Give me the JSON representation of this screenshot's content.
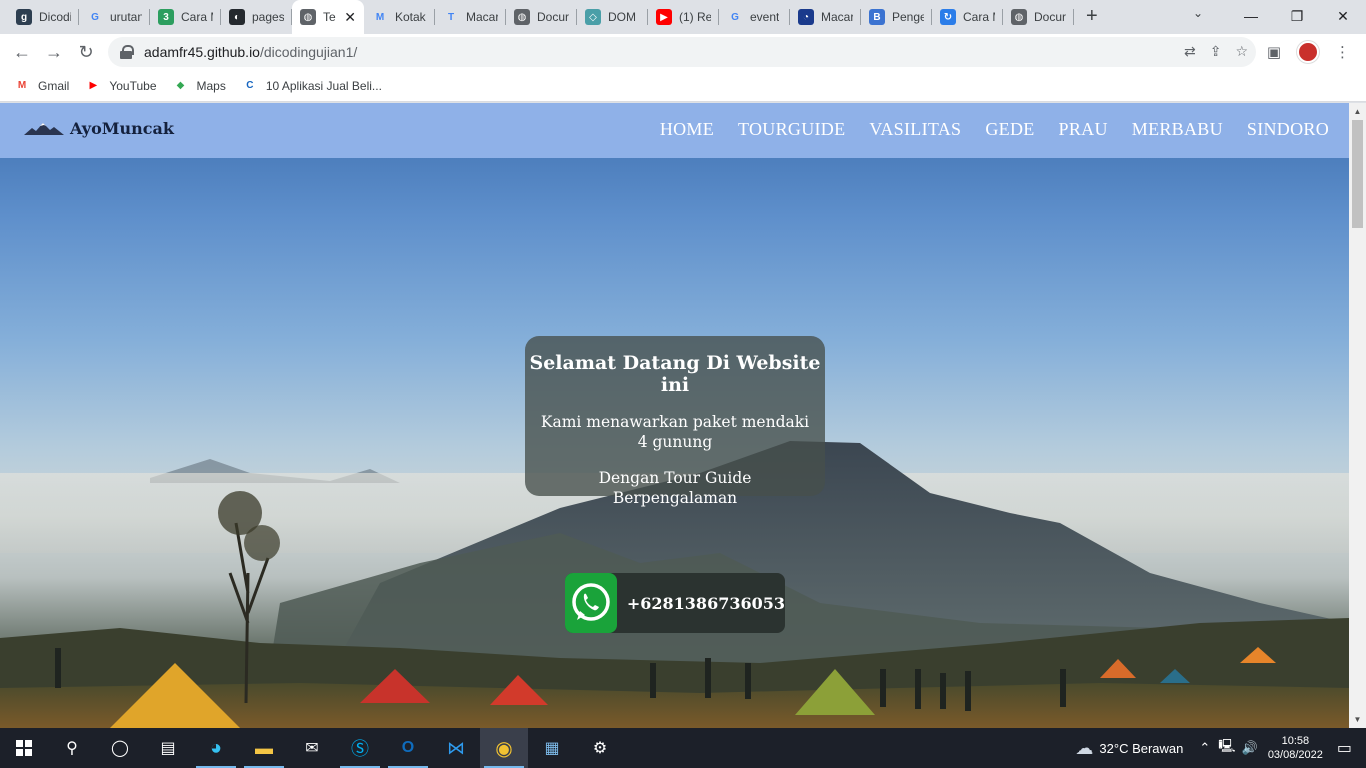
{
  "tabs": [
    {
      "title": "Dicodi",
      "favicon": "dicoding-icon",
      "color": "#2d3e50",
      "glyph": "g"
    },
    {
      "title": "urutan",
      "favicon": "google-icon",
      "color": "#ffffff",
      "glyph": "G"
    },
    {
      "title": "Cara M",
      "favicon": "three-icon",
      "color": "#2c9e5f",
      "glyph": "3"
    },
    {
      "title": "pages",
      "favicon": "github-icon",
      "color": "#24292e",
      "glyph": "◐"
    },
    {
      "title": "Te",
      "favicon": "globe-icon",
      "color": "#5f6368",
      "glyph": "◍",
      "active": true
    },
    {
      "title": "Kotak",
      "favicon": "gmail-icon",
      "color": "#ffffff",
      "glyph": "M"
    },
    {
      "title": "Macar",
      "favicon": "t-icon",
      "color": "#ffffff",
      "glyph": "T"
    },
    {
      "title": "Docur",
      "favicon": "globe-icon",
      "color": "#5f6368",
      "glyph": "◍"
    },
    {
      "title": "DOM",
      "favicon": "dom-icon",
      "color": "#4a9fa8",
      "glyph": "◇"
    },
    {
      "title": "(1) Re",
      "favicon": "youtube-icon",
      "color": "#ff0000",
      "glyph": "▶"
    },
    {
      "title": "event",
      "favicon": "google-icon",
      "color": "#ffffff",
      "glyph": "G"
    },
    {
      "title": "Macar",
      "favicon": "edge-cursor-icon",
      "color": "#1a3a8c",
      "glyph": "◔"
    },
    {
      "title": "Penge",
      "favicon": "b-icon",
      "color": "#3b73d1",
      "glyph": "B"
    },
    {
      "title": "Cara M",
      "favicon": "refresh-blue-icon",
      "color": "#2b7de9",
      "glyph": "↻"
    },
    {
      "title": "Docur",
      "favicon": "globe-icon",
      "color": "#5f6368",
      "glyph": "◍"
    }
  ],
  "browser": {
    "url_host": "adamfr45.github.io",
    "url_path": "/dicodingujian1/"
  },
  "bookmarks": [
    {
      "label": "Gmail",
      "icon": "gmail-icon",
      "glyph": "M",
      "color": "#ea4335"
    },
    {
      "label": "YouTube",
      "icon": "youtube-icon",
      "glyph": "▶",
      "color": "#ff0000"
    },
    {
      "label": "Maps",
      "icon": "maps-pin-icon",
      "glyph": "◆",
      "color": "#34a853"
    },
    {
      "label": "10 Aplikasi Jual Beli...",
      "icon": "site-icon",
      "glyph": "C",
      "color": "#1565c0"
    }
  ],
  "site": {
    "brand": "AyoMuncak",
    "menu": [
      "HOME",
      "TOURGUIDE",
      "VASILITAS",
      "GEDE",
      "PRAU",
      "MERBABU",
      "SINDORO"
    ],
    "welcome_title": "Selamat Datang Di Website ini",
    "welcome_line1": "Kami menawarkan paket mendaki 4 gunung",
    "welcome_line2": "Dengan Tour Guide Berpengalaman",
    "whatsapp_number": "+6281386736053",
    "navbar_color": "#8fb1e8"
  },
  "taskbar": {
    "weather": "32°C  Berawan",
    "time": "10:58",
    "date": "03/08/2022"
  }
}
